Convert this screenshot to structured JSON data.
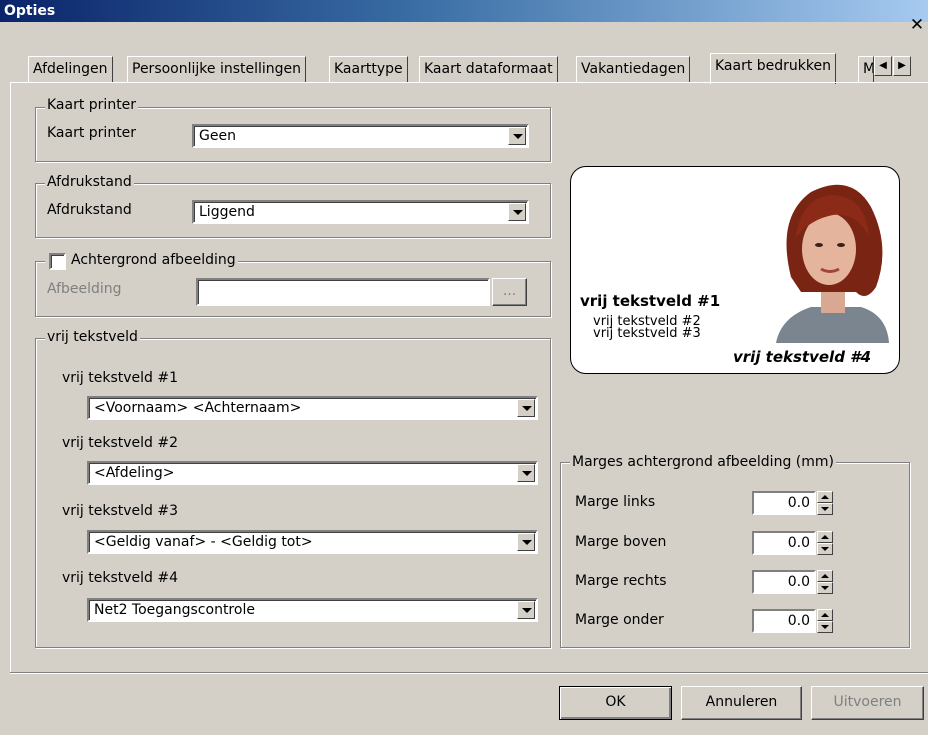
{
  "window": {
    "title": "Opties",
    "close_glyph": "✕"
  },
  "tabs": [
    {
      "label": "Afdelingen"
    },
    {
      "label": "Persoonlijke instellingen"
    },
    {
      "label": "Kaarttype"
    },
    {
      "label": "Kaart dataformaat"
    },
    {
      "label": "Vakantiedagen"
    },
    {
      "label": "Kaart bedrukken",
      "active": true
    },
    {
      "label": "M"
    }
  ],
  "tab_scroll": {
    "left_icon": "arrow-left-icon",
    "right_icon": "arrow-right-icon",
    "left_glyph": "◀",
    "right_glyph": "▶"
  },
  "printer_group": {
    "legend": "Kaart printer",
    "label": "Kaart printer",
    "value": "Geen"
  },
  "orientation_group": {
    "legend": "Afdrukstand",
    "label": "Afdrukstand",
    "value": "Liggend"
  },
  "background_group": {
    "legend": "Achtergrond afbeelding",
    "checked": false,
    "label": "Afbeelding",
    "value": "",
    "browse_label": "..."
  },
  "text_fields_group": {
    "legend": "vrij tekstveld",
    "fields": [
      {
        "label": "vrij tekstveld #1",
        "value": "<Voornaam> <Achternaam>"
      },
      {
        "label": "vrij tekstveld #2",
        "value": "<Afdeling>"
      },
      {
        "label": "vrij tekstveld #3",
        "value": "<Geldig vanaf> - <Geldig tot>"
      },
      {
        "label": "vrij tekstveld #4",
        "value": "Net2 Toegangscontrole"
      }
    ]
  },
  "card_preview": {
    "line1": "vrij tekstveld #1",
    "line2": "vrij tekstveld #2",
    "line3": "vrij tekstveld #3",
    "line4": "vrij tekstveld #4"
  },
  "margins_group": {
    "legend": "Marges achtergrond afbeelding (mm)",
    "rows": [
      {
        "label": "Marge links",
        "value": "0.0"
      },
      {
        "label": "Marge boven",
        "value": "0.0"
      },
      {
        "label": "Marge rechts",
        "value": "0.0"
      },
      {
        "label": "Marge onder",
        "value": "0.0"
      }
    ]
  },
  "buttons": {
    "ok": "OK",
    "cancel": "Annuleren",
    "apply": "Uitvoeren"
  },
  "colors": {
    "titlebar": "#0a246a",
    "face": "#d4d0c8",
    "disabled": "#808080"
  }
}
